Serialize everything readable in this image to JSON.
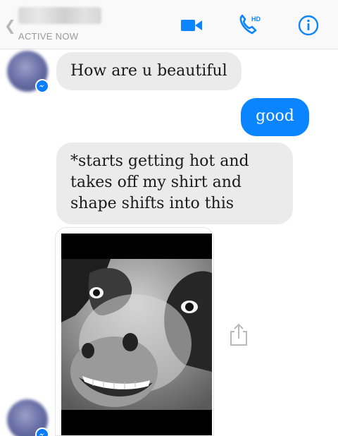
{
  "header": {
    "status": "ACTIVE NOW",
    "back_icon": "chevron-left-icon",
    "video_icon": "video-camera-icon",
    "call_icon": "phone-hd-icon",
    "call_badge": "HD",
    "info_icon": "info-circle-icon"
  },
  "colors": {
    "accent": "#0a84ff",
    "incoming_bubble": "#ebebeb",
    "header_bg": "#f9f9f9"
  },
  "messages": [
    {
      "from": "them",
      "text": "How are u beautiful"
    },
    {
      "from": "me",
      "text": "good"
    },
    {
      "from": "them",
      "lines": [
        "*starts getting hot and",
        "takes off my shirt and",
        "shape shifts into this"
      ]
    }
  ],
  "attachment": {
    "type": "image",
    "subject": "smiling cow photo",
    "share_icon": "share-icon"
  }
}
